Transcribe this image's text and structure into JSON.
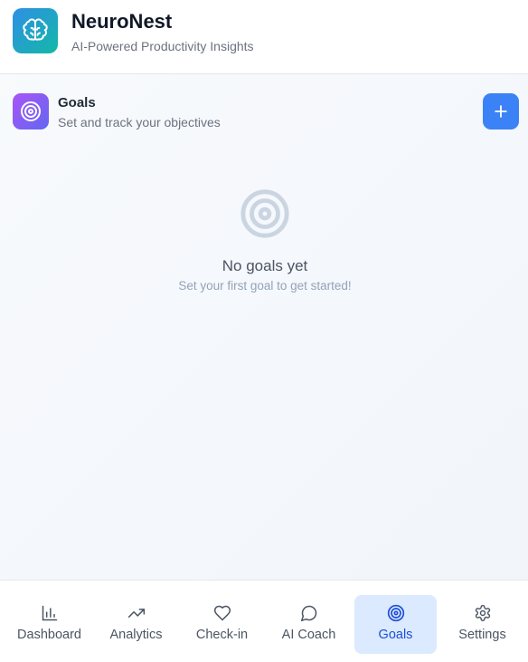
{
  "app": {
    "title": "NeuroNest",
    "subtitle": "AI-Powered Productivity Insights",
    "logo_icon": "brain-icon"
  },
  "section": {
    "title": "Goals",
    "subtitle": "Set and track your objectives",
    "icon": "target-icon",
    "add_icon": "plus-icon"
  },
  "empty_state": {
    "icon": "target-icon",
    "title": "No goals yet",
    "subtitle": "Set your first goal to get started!"
  },
  "nav": {
    "active": "Goals",
    "items": [
      {
        "label": "Dashboard",
        "icon": "bar-chart-icon"
      },
      {
        "label": "Analytics",
        "icon": "trending-up-icon"
      },
      {
        "label": "Check-in",
        "icon": "heart-icon"
      },
      {
        "label": "AI Coach",
        "icon": "message-circle-icon"
      },
      {
        "label": "Goals",
        "icon": "target-icon"
      },
      {
        "label": "Settings",
        "icon": "gear-icon"
      }
    ]
  },
  "colors": {
    "accent": "#3b82f6",
    "active_nav_bg": "#dbeafe",
    "active_nav_text": "#1d4ed8"
  }
}
